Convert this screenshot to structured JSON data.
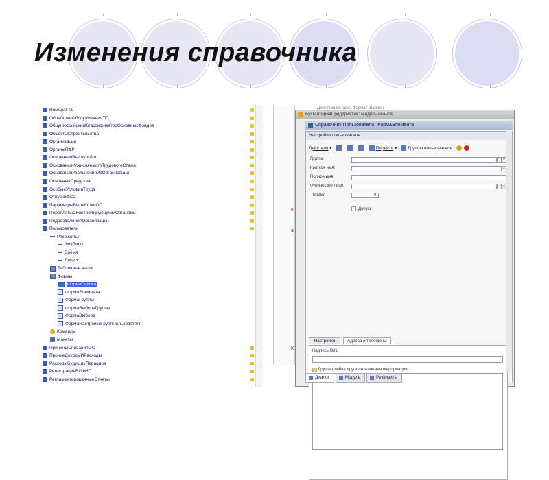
{
  "slide_title": "Изменения справочника",
  "tree": {
    "items": [
      {
        "label": "НомераГТД",
        "icon": "table-icon",
        "level": 0
      },
      {
        "label": "ОбработкиОбслуживанияТО",
        "icon": "table-icon",
        "level": 0
      },
      {
        "label": "ОбщероссийскийКлассификаторОсновныхФондов",
        "icon": "table-icon",
        "level": 0
      },
      {
        "label": "ОбъектыСтроительства",
        "icon": "table-icon",
        "level": 0
      },
      {
        "label": "Организации",
        "icon": "table-icon",
        "level": 0
      },
      {
        "label": "ОрганыПФР",
        "icon": "table-icon",
        "level": 0
      },
      {
        "label": "ОснованияВыслугиЛет",
        "icon": "table-icon",
        "level": 0
      },
      {
        "label": "ОснованияИсчисляемогоТрудовогоСтажа",
        "icon": "table-icon",
        "level": 0
      },
      {
        "label": "ОснованияУвольненияИзОрганизаций",
        "icon": "table-icon",
        "level": 0
      },
      {
        "label": "ОсновныеСредства",
        "icon": "table-icon",
        "level": 0
      },
      {
        "label": "ОсобыеУсловияТруда",
        "icon": "table-icon",
        "level": 0
      },
      {
        "label": "ОтпускиФСС",
        "icon": "table-icon",
        "level": 0
      },
      {
        "label": "ПараметрыВыработкиОС",
        "icon": "table-icon",
        "level": 0
      },
      {
        "label": "ПереплатыСКонтролирующимиОрганами",
        "icon": "table-icon",
        "level": 0
      },
      {
        "label": "ПодразделенияОрганизаций",
        "icon": "table-icon",
        "level": 0
      },
      {
        "label": "Пользователи",
        "icon": "table-icon",
        "level": 0
      },
      {
        "label": "Реквизиты",
        "icon": "attributes-icon",
        "level": 1
      },
      {
        "label": "ФизЛицо",
        "icon": "attribute-dash-icon",
        "level": 2
      },
      {
        "label": "Время",
        "icon": "attribute-dash-icon",
        "level": 2
      },
      {
        "label": "Допуск",
        "icon": "attribute-dash-icon",
        "level": 2
      },
      {
        "label": "Табличные части",
        "icon": "tabular-icon",
        "level": 1
      },
      {
        "label": "Формы",
        "icon": "forms-icon",
        "level": 1
      },
      {
        "label": "ФормаСписка",
        "icon": "form-icon",
        "level": 2,
        "selected": true
      },
      {
        "label": "ФормаЭлемента",
        "icon": "form-icon",
        "level": 2
      },
      {
        "label": "ФормаГруппы",
        "icon": "form-icon",
        "level": 2
      },
      {
        "label": "ФормаВыбораГруппы",
        "icon": "form-icon",
        "level": 2
      },
      {
        "label": "ФормаВыбора",
        "icon": "form-icon",
        "level": 2
      },
      {
        "label": "ФормаНастройкиГруппПользователя",
        "icon": "form-icon",
        "level": 2
      },
      {
        "label": "Команды",
        "icon": "commands-icon",
        "level": 1
      },
      {
        "label": "Макеты",
        "icon": "templates-icon",
        "level": 1
      },
      {
        "label": "ПричиныСписанияОС",
        "icon": "table-icon",
        "level": 0
      },
      {
        "label": "ПрочиеДоходыИРасходы",
        "icon": "table-icon",
        "level": 0
      },
      {
        "label": "РасходыБудущихПериодов",
        "icon": "table-icon",
        "level": 0
      },
      {
        "label": "РегистрацияВИФНС",
        "icon": "table-icon",
        "level": 0
      },
      {
        "label": "РегламентированныеОтчеты",
        "icon": "table-icon",
        "level": 0
      }
    ]
  },
  "behind_menu": "Действия  Вставка  Формат  Шаблон",
  "window": {
    "app_title": "БухгалтерияПредприятия: Модуль сеанса",
    "form_title": "Справочник Пользователи: ФормаЭлемента",
    "header": "Настройки пользователя",
    "toolbar": {
      "actions": "Действия",
      "goto": "Перейти",
      "groups": "Группы пользователя"
    },
    "fields": {
      "group": "Группа:",
      "short_name": "Краткое имя:",
      "full_name": "Полное имя:",
      "person": "Физическое лицо:",
      "time": "Время",
      "time_value": "0",
      "access": "Допуск"
    },
    "tabs": [
      "Настройки",
      "Адреса и телефоны"
    ],
    "pane": {
      "label_ki": "Надпись КИ1",
      "other_contact": "Другое (любая другая контактная информация):"
    },
    "bottom_tabs": [
      "Диалог",
      "Модуль",
      "Реквизиты"
    ]
  }
}
